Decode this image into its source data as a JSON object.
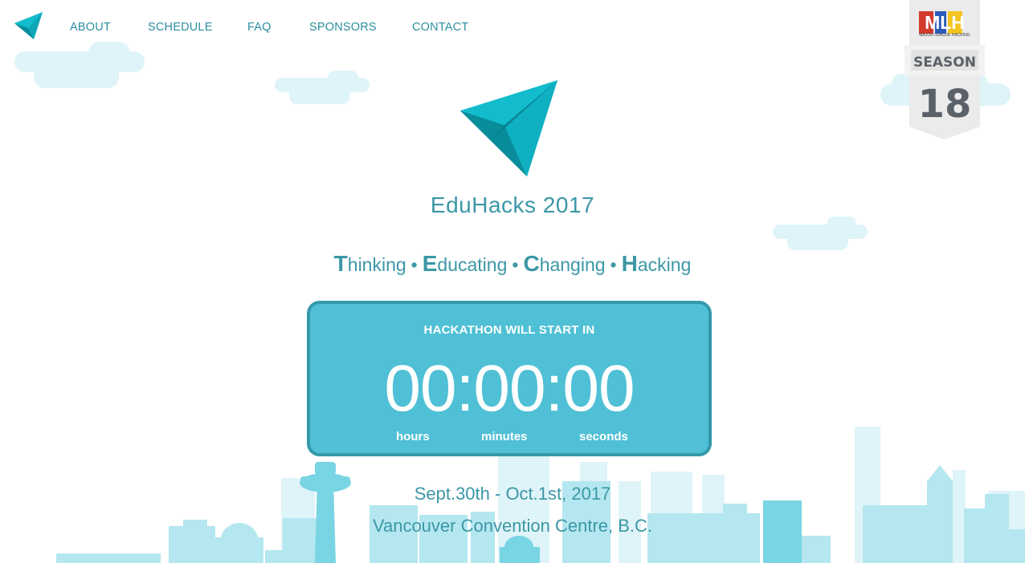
{
  "nav": {
    "items": [
      {
        "label": "ABOUT"
      },
      {
        "label": "SCHEDULE"
      },
      {
        "label": "FAQ"
      },
      {
        "label": "SPONSORS"
      },
      {
        "label": "CONTACT"
      }
    ]
  },
  "hero": {
    "title": "EduHacks 2017",
    "tagline": [
      {
        "cap": "T",
        "rest": "hinking"
      },
      {
        "cap": "E",
        "rest": "ducating"
      },
      {
        "cap": "C",
        "rest": "hanging"
      },
      {
        "cap": "H",
        "rest": "acking"
      }
    ],
    "separator": "•"
  },
  "countdown": {
    "heading": "HACKATHON WILL START IN",
    "time": "00:00:00",
    "units": {
      "hours": "hours",
      "minutes": "minutes",
      "seconds": "seconds"
    }
  },
  "event": {
    "date": "Sept.30th - Oct.1st, 2017",
    "venue": "Vancouver Convention Centre, B.C."
  },
  "mlh_badge": {
    "logo_text": "MLH",
    "logo_subtext": "MAJOR LEAGUE HACKING",
    "season_label": "SEASON",
    "season_number": "18"
  },
  "colors": {
    "accent": "#2b8fa0",
    "countdown_bg": "#4fc0d5",
    "countdown_border": "#3499ab",
    "cloud": "#dff4f8",
    "skyline": "#b4e7ef",
    "plane_light": "#12bccd",
    "plane_dark": "#0a8d9b"
  },
  "icons": {
    "nav_logo": "paper-plane-icon",
    "hero_logo": "paper-plane-icon"
  }
}
